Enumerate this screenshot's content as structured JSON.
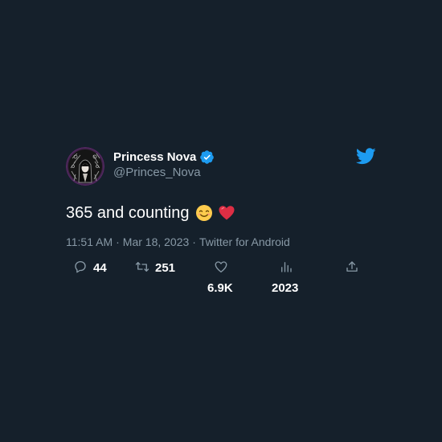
{
  "tweet": {
    "author": {
      "display_name": "Princess Nova",
      "handle": "@Princes_Nova",
      "verified": true,
      "avatar_icon": "avatar-portrait"
    },
    "brand_icon": "twitter-bird-icon",
    "text": "365 and counting",
    "emojis": [
      "smiling-face-emoji",
      "red-heart-emoji"
    ],
    "meta": {
      "time": "11:51 AM",
      "date": "Mar 18, 2023",
      "source": "Twitter for Android",
      "separator": "·"
    },
    "actions": {
      "replies": "44",
      "retweets": "251",
      "likes": "6.9K",
      "views": "2023"
    }
  },
  "colors": {
    "background": "#15202b",
    "primary_text": "#ffffff",
    "secondary_text": "#8899a6",
    "brand_blue": "#1d9bf0"
  }
}
